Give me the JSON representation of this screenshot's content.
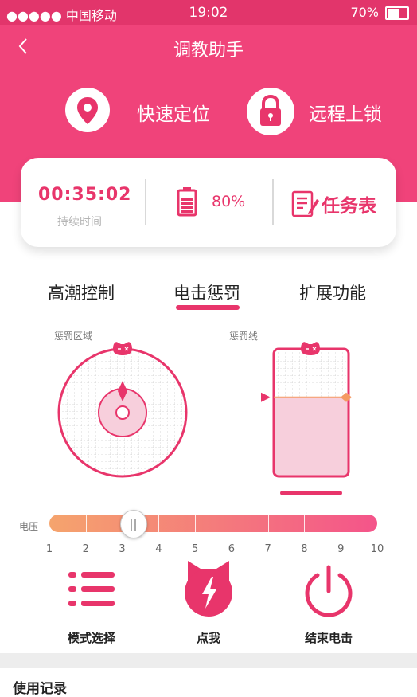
{
  "status_bar": {
    "carrier": "●●●●● 中国移动",
    "time": "19:02",
    "battery_percent": "70%",
    "battery_level": 0.7
  },
  "nav": {
    "title": "调教助手"
  },
  "top_actions": [
    {
      "label": "快速定位",
      "icon": "location-pin-icon"
    },
    {
      "label": "远程上锁",
      "icon": "padlock-icon"
    }
  ],
  "stats_card": {
    "timer": "00:35:02",
    "timer_label": "持续时间",
    "battery": "80%",
    "battery_level": 0.8,
    "task_label": "任务表"
  },
  "tabs": [
    {
      "label": "高潮控制",
      "active": false
    },
    {
      "label": "电击惩罚",
      "active": true
    },
    {
      "label": "扩展功能",
      "active": false
    }
  ],
  "panels": {
    "zone_label": "惩罚区域",
    "line_label": "惩罚线",
    "line_level": 0.62
  },
  "voltage": {
    "label": "电压",
    "ticks": [
      "1",
      "2",
      "3",
      "4",
      "5",
      "6",
      "7",
      "8",
      "9",
      "10"
    ],
    "value": 3.3
  },
  "bottom_actions": [
    {
      "label": "模式选择",
      "icon": "list-icon"
    },
    {
      "label": "点我",
      "icon": "lightning-cat-icon"
    },
    {
      "label": "结束电击",
      "icon": "power-icon"
    }
  ],
  "records": {
    "title": "使用记录"
  },
  "colors": {
    "accent": "#f0437a",
    "accent_dark": "#e8356b",
    "orange": "#f5a46d"
  }
}
